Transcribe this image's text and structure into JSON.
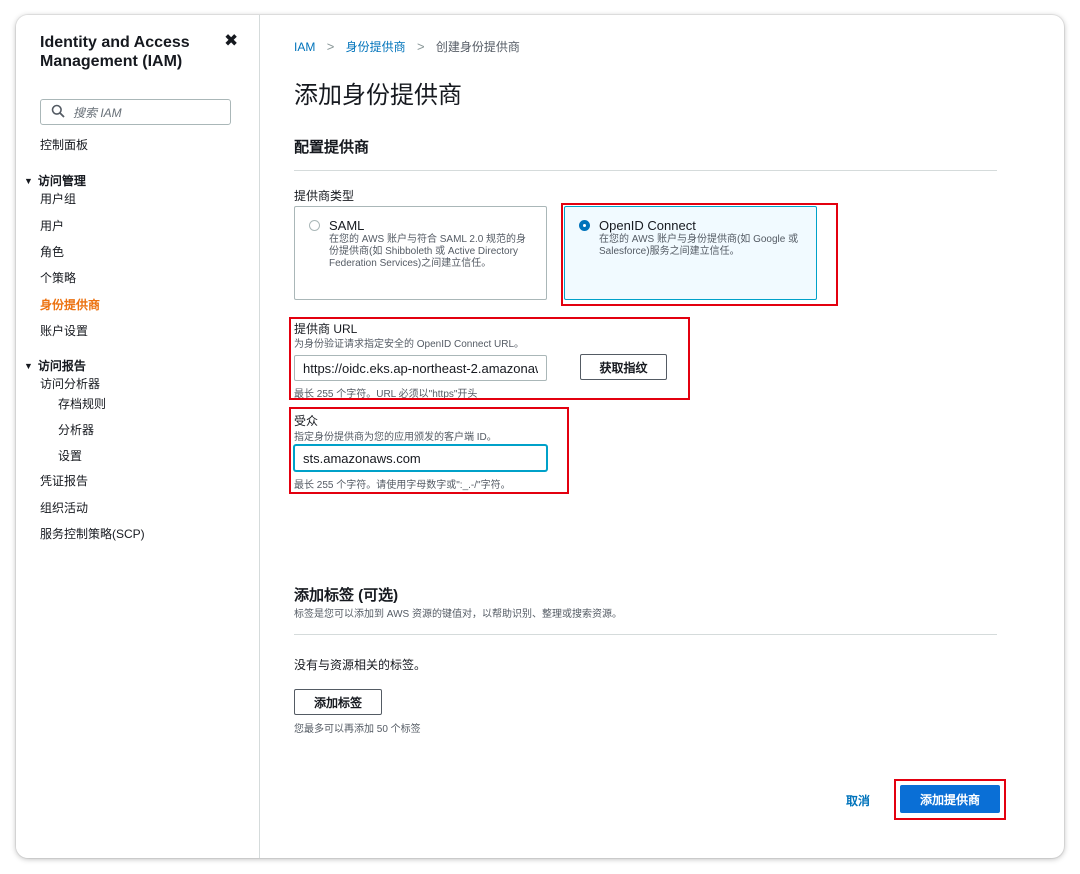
{
  "sidebar": {
    "title": "Identity and Access Management (IAM)",
    "close_glyph": "✖",
    "search_placeholder": "搜索 IAM",
    "dashboard": "控制面板",
    "access_mgmt": {
      "heading": "访问管理",
      "items": [
        "用户组",
        "用户",
        "角色",
        "个策略",
        "身份提供商",
        "账户设置"
      ]
    },
    "access_reports": {
      "heading": "访问报告",
      "analyzer": "访问分析器",
      "analyzer_items": [
        "存档规则",
        "分析器",
        "设置"
      ],
      "items": [
        "凭证报告",
        "组织活动",
        "服务控制策略(SCP)"
      ]
    },
    "active_item": "身份提供商",
    "active_color": "#ec7211"
  },
  "breadcrumb": {
    "items": [
      "IAM",
      "身份提供商"
    ],
    "current": "创建身份提供商",
    "separator": ">"
  },
  "page_title": "添加身份提供商",
  "config": {
    "heading": "配置提供商",
    "provider_type_label": "提供商类型",
    "options": [
      {
        "name": "SAML",
        "desc": "在您的 AWS 账户与符合 SAML 2.0 规范的身份提供商(如 Shibboleth 或 Active Directory Federation Services)之间建立信任。",
        "selected": false
      },
      {
        "name": "OpenID Connect",
        "desc": "在您的 AWS 账户与身份提供商(如 Google 或 Salesforce)服务之间建立信任。",
        "selected": true
      }
    ],
    "url": {
      "label": "提供商 URL",
      "desc": "为身份验证请求指定安全的 OpenID Connect URL。",
      "value": "https://oidc.eks.ap-northeast-2.amazonaw",
      "button": "获取指纹",
      "constraint": "最长 255 个字符。URL 必须以\"https\"开头"
    },
    "audience": {
      "label": "受众",
      "desc": "指定身份提供商为您的应用颁发的客户端 ID。",
      "value": "sts.amazonaws.com",
      "constraint": "最长 255 个字符。请使用字母数字或\":_.-/\"字符。"
    }
  },
  "tags": {
    "heading": "添加标签 (可选)",
    "desc": "标签是您可以添加到 AWS 资源的键值对，以帮助识别、整理或搜索资源。",
    "empty": "没有与资源相关的标签。",
    "add_button": "添加标签",
    "limit": "您最多可以再添加 50 个标签"
  },
  "footer": {
    "cancel": "取消",
    "submit": "添加提供商"
  },
  "colors": {
    "link": "#0073bb",
    "primary": "#0a6fd6",
    "highlight": "#e3000f",
    "selected_border": "#00a1c9"
  }
}
